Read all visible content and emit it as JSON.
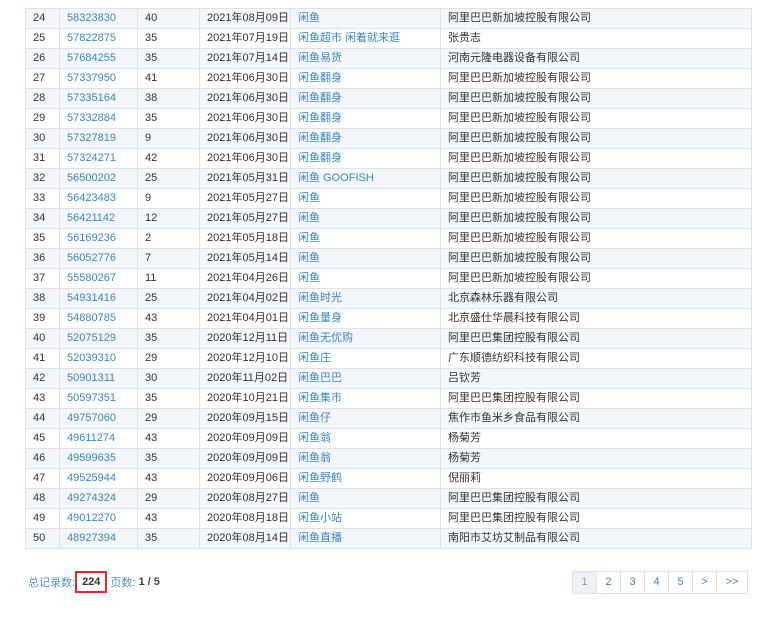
{
  "rows": [
    [
      "24",
      "58323830",
      "40",
      "2021年08月09日",
      "闲鱼",
      "阿里巴巴新加坡控股有限公司"
    ],
    [
      "25",
      "57822875",
      "35",
      "2021年07月19日",
      "闲鱼超市 闲着就来逛",
      "张贵志"
    ],
    [
      "26",
      "57684255",
      "35",
      "2021年07月14日",
      "闲鱼易货",
      "河南元隆电器设备有限公司"
    ],
    [
      "27",
      "57337950",
      "41",
      "2021年06月30日",
      "闲鱼翻身",
      "阿里巴巴新加坡控股有限公司"
    ],
    [
      "28",
      "57335164",
      "38",
      "2021年06月30日",
      "闲鱼翻身",
      "阿里巴巴新加坡控股有限公司"
    ],
    [
      "29",
      "57332884",
      "35",
      "2021年06月30日",
      "闲鱼翻身",
      "阿里巴巴新加坡控股有限公司"
    ],
    [
      "30",
      "57327819",
      "9",
      "2021年06月30日",
      "闲鱼翻身",
      "阿里巴巴新加坡控股有限公司"
    ],
    [
      "31",
      "57324271",
      "42",
      "2021年06月30日",
      "闲鱼翻身",
      "阿里巴巴新加坡控股有限公司"
    ],
    [
      "32",
      "56500202",
      "25",
      "2021年05月31日",
      "闲鱼 GOOFISH",
      "阿里巴巴新加坡控股有限公司"
    ],
    [
      "33",
      "56423483",
      "9",
      "2021年05月27日",
      "闲鱼",
      "阿里巴巴新加坡控股有限公司"
    ],
    [
      "34",
      "56421142",
      "12",
      "2021年05月27日",
      "闲鱼",
      "阿里巴巴新加坡控股有限公司"
    ],
    [
      "35",
      "56169236",
      "2",
      "2021年05月18日",
      "闲鱼",
      "阿里巴巴新加坡控股有限公司"
    ],
    [
      "36",
      "56052776",
      "7",
      "2021年05月14日",
      "闲鱼",
      "阿里巴巴新加坡控股有限公司"
    ],
    [
      "37",
      "55580267",
      "11",
      "2021年04月26日",
      "闲鱼",
      "阿里巴巴新加坡控股有限公司"
    ],
    [
      "38",
      "54931416",
      "25",
      "2021年04月02日",
      "闲鱼时光",
      "北京森林乐器有限公司"
    ],
    [
      "39",
      "54880785",
      "43",
      "2021年04月01日",
      "闲鱼量身",
      "北京盛仕华晨科技有限公司"
    ],
    [
      "40",
      "52075129",
      "35",
      "2020年12月11日",
      "闲鱼无优购",
      "阿里巴巴集团控股有限公司"
    ],
    [
      "41",
      "52039310",
      "29",
      "2020年12月10日",
      "闲鱼庄",
      "广东顺德纺织科技有限公司"
    ],
    [
      "42",
      "50901311",
      "30",
      "2020年11月02日",
      "闲鱼巴巴",
      "吕钦芳"
    ],
    [
      "43",
      "50597351",
      "35",
      "2020年10月21日",
      "闲鱼集市",
      "阿里巴巴集团控股有限公司"
    ],
    [
      "44",
      "49757060",
      "29",
      "2020年09月15日",
      "闲鱼仔",
      "焦作市鱼米乡食品有限公司"
    ],
    [
      "45",
      "49611274",
      "43",
      "2020年09月09日",
      "闲鱼翁",
      "杨菊芳"
    ],
    [
      "46",
      "49599635",
      "35",
      "2020年09月09日",
      "闲鱼翁",
      "杨菊芳"
    ],
    [
      "47",
      "49525944",
      "43",
      "2020年09月06日",
      "闲鱼野鹤",
      "倪丽莉"
    ],
    [
      "48",
      "49274324",
      "29",
      "2020年08月27日",
      "闲鱼",
      "阿里巴巴集团控股有限公司"
    ],
    [
      "49",
      "49012270",
      "43",
      "2020年08月18日",
      "闲鱼小站",
      "阿里巴巴集团控股有限公司"
    ],
    [
      "50",
      "48927394",
      "35",
      "2020年08月14日",
      "闲鱼直播",
      "南阳市艾坊艾制品有限公司"
    ]
  ],
  "footer": {
    "total_label": "总记录数:",
    "total_value": "224",
    "pages_label": "页数:",
    "pages_value": "1 / 5"
  },
  "pager": [
    "1",
    "2",
    "3",
    "4",
    "5",
    ">",
    ">>"
  ],
  "colors": {
    "link": "#3a86c8",
    "highlight_box": "#e12a2a",
    "row_stripe": "#f4f6f9"
  }
}
